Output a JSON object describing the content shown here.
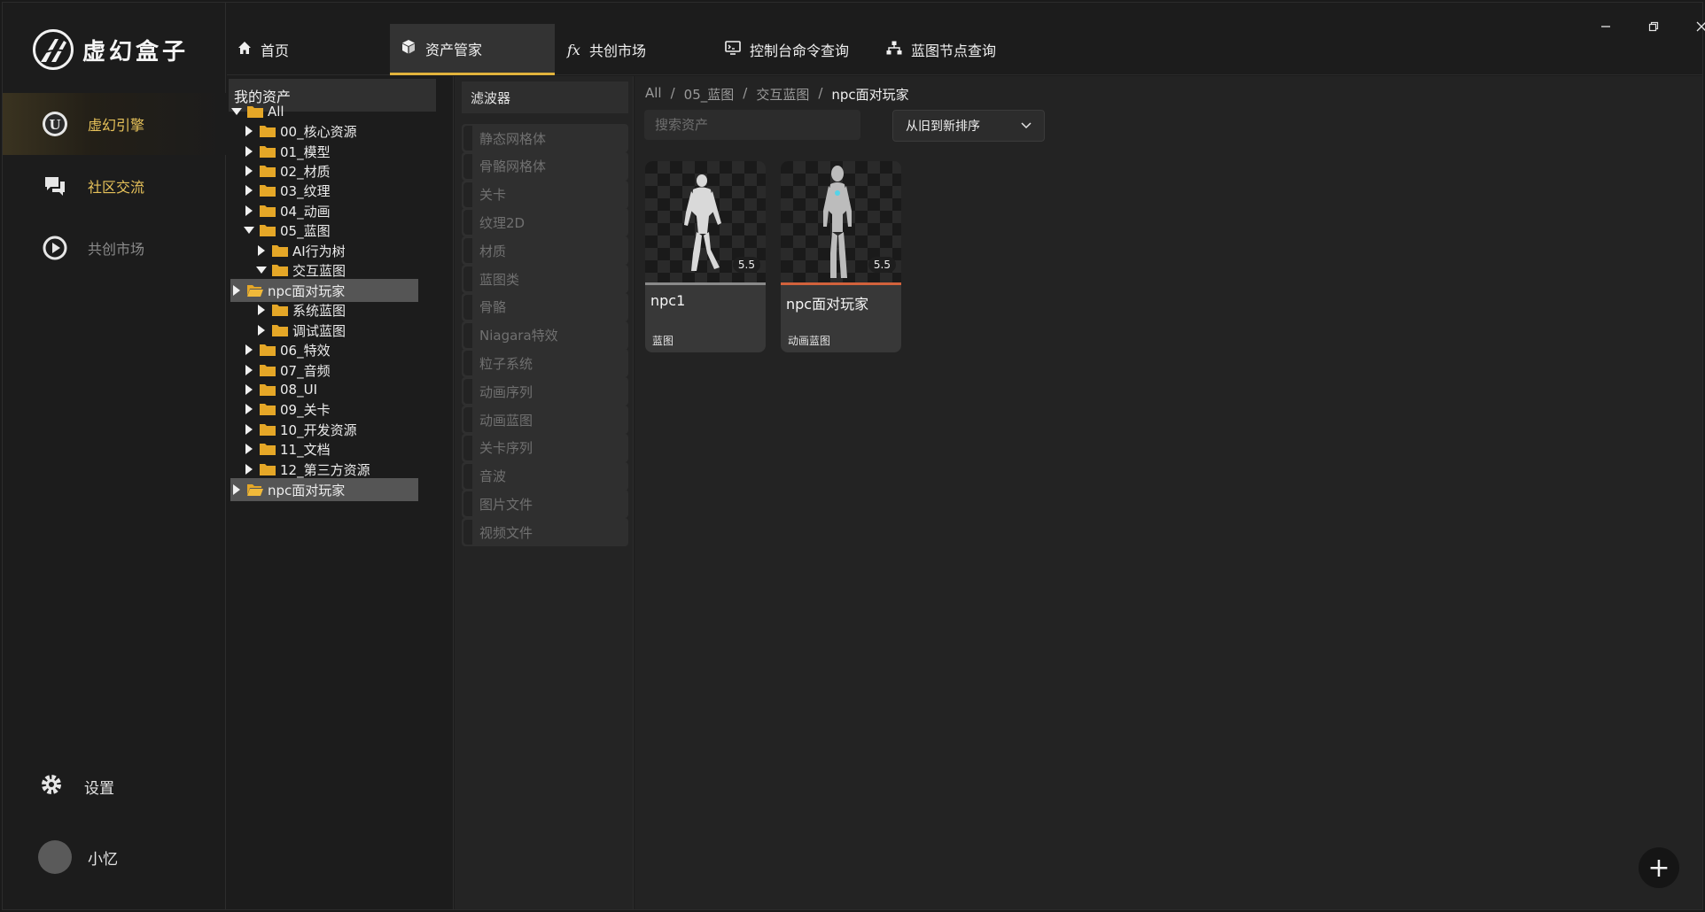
{
  "app": {
    "logo_text": "虚幻盒子",
    "brand_color": "#e7c25a",
    "accent_color": "#e2b33c"
  },
  "sidebar": {
    "items": [
      {
        "label": "虚幻引擎",
        "icon": "unreal-engine-icon",
        "active": true
      },
      {
        "label": "社区交流",
        "icon": "chat-bubbles-icon",
        "active": false
      },
      {
        "label": "共创市场",
        "icon": "play-circle-icon",
        "active": false
      }
    ],
    "settings_label": "设置",
    "user_name": "小忆"
  },
  "topbar": {
    "tabs": [
      {
        "label": "首页",
        "icon": "home-icon"
      },
      {
        "label": "资产管家",
        "icon": "cube-icon",
        "active": true
      },
      {
        "label": "共创市场",
        "icon": "fx-icon"
      },
      {
        "label": "控制台命令查询",
        "icon": "console-icon"
      },
      {
        "label": "蓝图节点查询",
        "icon": "hierarchy-icon"
      }
    ],
    "window_controls": [
      "minimize-icon",
      "restore-icon",
      "close-icon"
    ]
  },
  "tree": {
    "header": "我的资产",
    "root": "All",
    "nodes": [
      {
        "label": "00_核心资源"
      },
      {
        "label": "01_模型"
      },
      {
        "label": "02_材质"
      },
      {
        "label": "03_纹理"
      },
      {
        "label": "04_动画"
      },
      {
        "label": "05_蓝图"
      },
      {
        "label": "AI行为树"
      },
      {
        "label": "交互蓝图"
      },
      {
        "label": "npc面对玩家"
      },
      {
        "label": "系统蓝图"
      },
      {
        "label": "调试蓝图"
      },
      {
        "label": "06_特效"
      },
      {
        "label": "07_音频"
      },
      {
        "label": "08_UI"
      },
      {
        "label": "09_关卡"
      },
      {
        "label": "10_开发资源"
      },
      {
        "label": "11_文档"
      },
      {
        "label": "12_第三方资源"
      },
      {
        "label": "npc面对玩家"
      }
    ]
  },
  "filters": {
    "header": "滤波器",
    "items": [
      "静态网格体",
      "骨骼网格体",
      "关卡",
      "纹理2D",
      "材质",
      "蓝图类",
      "骨骼",
      "Niagara特效",
      "粒子系统",
      "动画序列",
      "动画蓝图",
      "关卡序列",
      "音波",
      "图片文件",
      "视频文件"
    ]
  },
  "main": {
    "breadcrumb": [
      "All",
      "/",
      "05_蓝图",
      "/",
      "交互蓝图",
      "/",
      "npc面对玩家"
    ],
    "search_placeholder": "搜索资产",
    "sort_label": "从旧到新排序",
    "assets": [
      {
        "name": "npc1",
        "type": "蓝图",
        "version": "5.5",
        "bar_color": "#8a8a8a"
      },
      {
        "name": "npc面对玩家",
        "type": "动画蓝图",
        "version": "5.5",
        "bar_color": "#d2623c"
      }
    ],
    "fab_label": "+"
  }
}
